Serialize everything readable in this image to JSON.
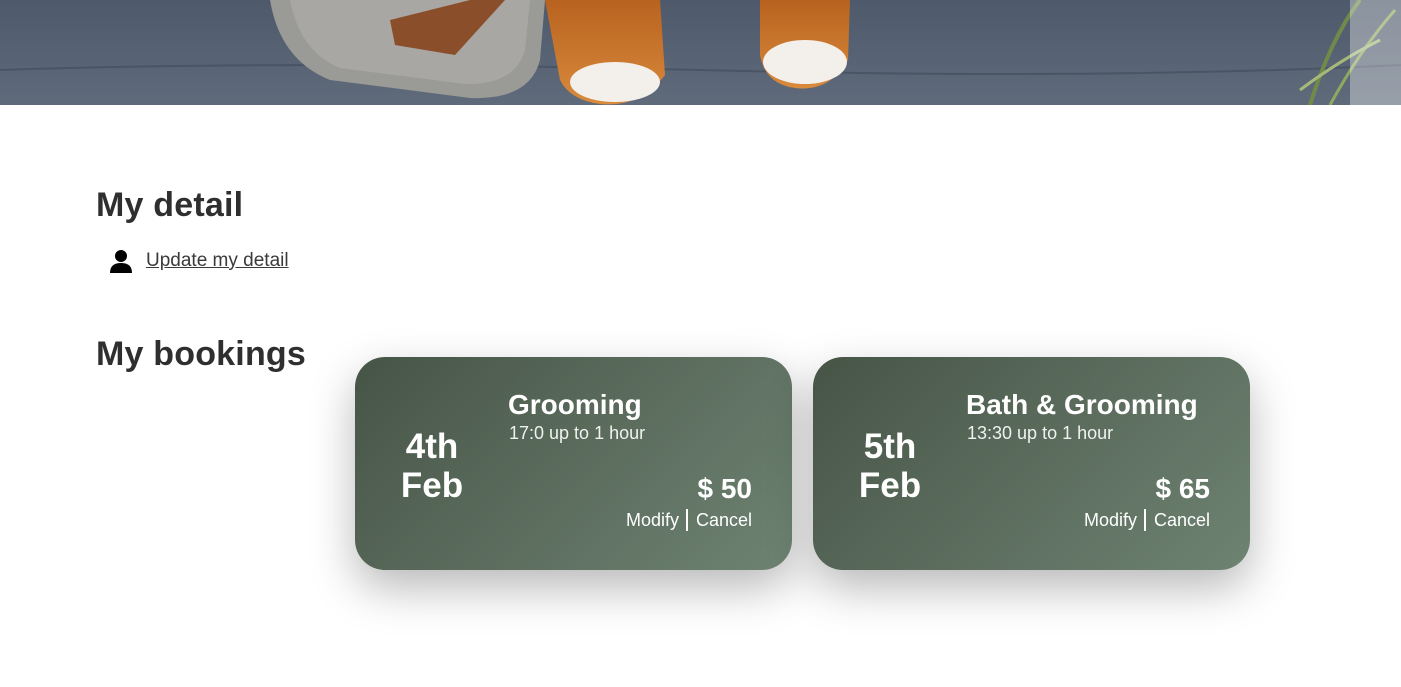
{
  "sections": {
    "detail_title": "My detail",
    "detail_link": "Update my detail",
    "bookings_title": "My bookings"
  },
  "bookings": [
    {
      "day": "4th",
      "month": "Feb",
      "service": "Grooming",
      "time": "17:0 up to 1 hour",
      "price": "$ 50",
      "modify_label": "Modify",
      "cancel_label": "Cancel"
    },
    {
      "day": "5th",
      "month": "Feb",
      "service": "Bath & Grooming",
      "time": "13:30 up to 1 hour",
      "price": "$ 65",
      "modify_label": "Modify",
      "cancel_label": "Cancel"
    }
  ],
  "icons": {
    "detail_icon": "person-icon"
  },
  "colors": {
    "card_gradient_start": "#465446",
    "card_gradient_end": "#6e8372",
    "heading": "#2f2f2f"
  }
}
